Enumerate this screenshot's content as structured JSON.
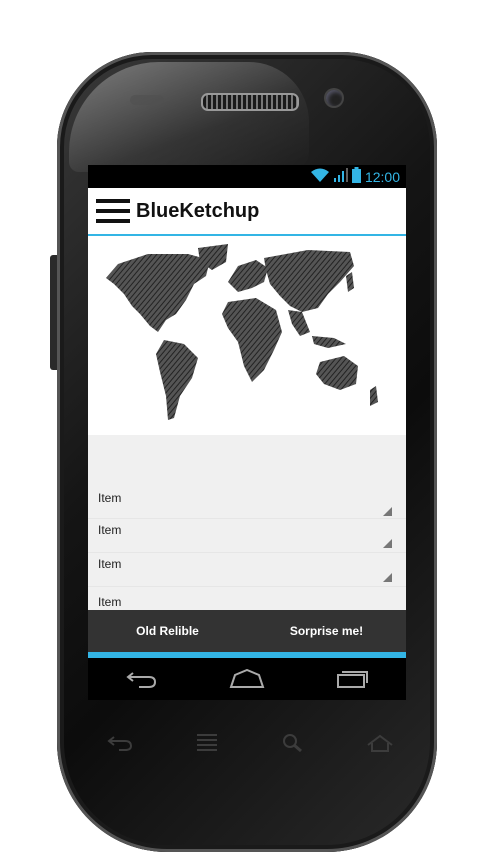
{
  "statusbar": {
    "time": "12:00",
    "icons": [
      "wifi-icon",
      "signal-icon",
      "battery-icon"
    ]
  },
  "actionbar": {
    "title": "BlueKetchup",
    "menu_icon": "hamburger-menu-icon"
  },
  "list": {
    "items": [
      {
        "label": "Item"
      },
      {
        "label": "Item"
      },
      {
        "label": "Item"
      },
      {
        "label": "Item"
      }
    ]
  },
  "buttons": {
    "left": "Old Relible",
    "right": "Sorprise me!"
  },
  "navbar": {
    "icons": [
      "back-icon",
      "home-icon",
      "recents-icon"
    ]
  },
  "hardware_keys": [
    "back-icon",
    "menu-icon",
    "search-icon",
    "home-icon"
  ],
  "colors": {
    "accent": "#33b5e5",
    "buttonbar": "#333333"
  }
}
